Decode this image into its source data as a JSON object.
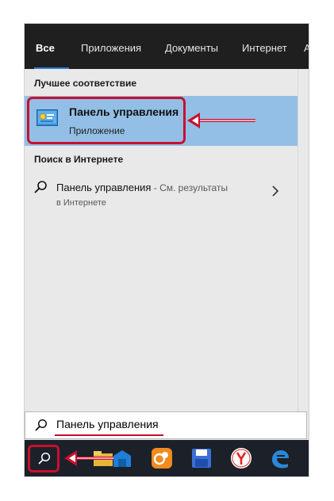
{
  "tabs": [
    "Все",
    "Приложения",
    "Документы",
    "Интернет",
    "А"
  ],
  "best_match": {
    "section_title": "Лучшее соответствие",
    "title": "Панель управления",
    "subtitle": "Приложение"
  },
  "web": {
    "section_title": "Поиск в Интернете",
    "query": "Панель управления",
    "suffix": " - См. результаты",
    "line2": "в Интернете"
  },
  "search_box": {
    "value": "Панель управления"
  },
  "taskbar": {
    "icons": [
      "search-icon",
      "file-explorer-icon",
      "store-icon",
      "uc-browser-icon",
      "save-app-icon",
      "yandex-browser-icon",
      "edge-icon"
    ]
  },
  "colors": {
    "accent": "#2d7dd2",
    "highlight": "#93bfe6",
    "annotation": "#c8102e",
    "tab_bar": "#1f1f1f",
    "taskbar": "#1c2129"
  }
}
